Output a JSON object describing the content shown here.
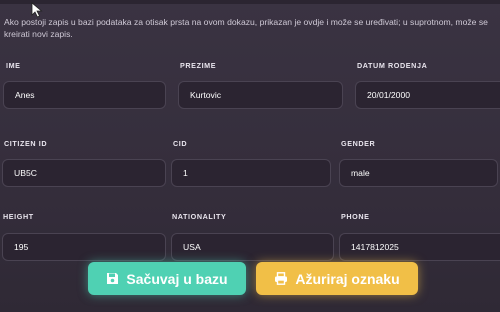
{
  "form": {
    "info_text": "Ako postoji zapis u bazi podataka za otisak prsta na ovom dokazu, prikazan je ovdje i može se uređivati; u suprotnom, može se kreirati novi zapis.",
    "fields": {
      "ime": {
        "label": "IME",
        "value": "Anes"
      },
      "prezime": {
        "label": "PREZIME",
        "value": "Kurtovic"
      },
      "datum_rodenja": {
        "label": "DATUM RODENJA",
        "value": "20/01/2000"
      },
      "citizen_id": {
        "label": "CITIZEN ID",
        "value": "UB5C"
      },
      "cid": {
        "label": "CID",
        "value": "1"
      },
      "gender": {
        "label": "GENDER",
        "value": "male"
      },
      "height": {
        "label": "HEIGHT",
        "value": "195"
      },
      "nationality": {
        "label": "NATIONALITY",
        "value": "USA"
      },
      "phone": {
        "label": "PHONE",
        "value": "1417812025"
      }
    }
  },
  "buttons": {
    "save": {
      "label": "Sačuvaj u bazu",
      "icon": "floppy-disk-icon",
      "color": "#4fd1b3"
    },
    "update": {
      "label": "Ažuriraj oznaku",
      "icon": "printer-icon",
      "color": "#f1bf47"
    }
  },
  "colors": {
    "background": "#37303f",
    "field_bg": "#2b2431"
  }
}
